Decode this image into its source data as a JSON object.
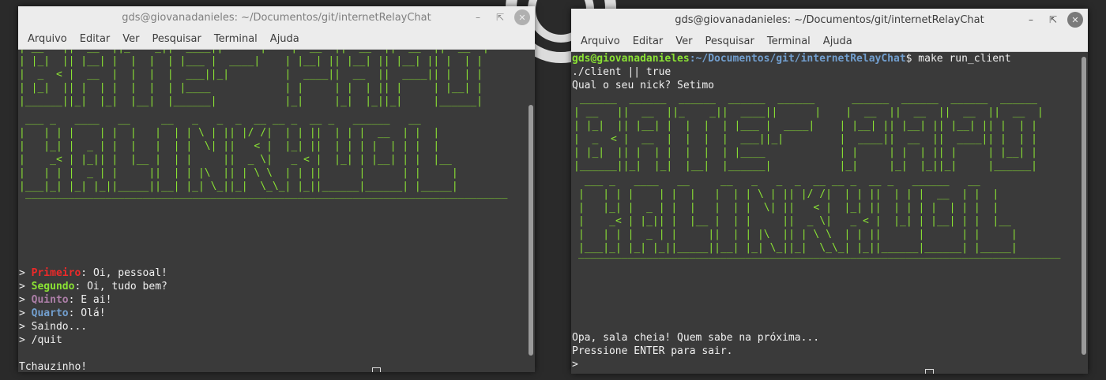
{
  "background": {
    "ring_color": "#dcdcdc",
    "desktop_color": "#2a2a2a"
  },
  "menu": [
    "Arquivo",
    "Editar",
    "Ver",
    "Pesquisar",
    "Terminal",
    "Ajuda"
  ],
  "left_window": {
    "title": "gds@giovanadanieles: ~/Documentos/git/internetRelayChat",
    "chat": [
      {
        "prompt": "> ",
        "nick": "Primeiro",
        "sep": ": ",
        "text": "Oi, pessoal!",
        "color": "#ef2929"
      },
      {
        "prompt": "> ",
        "nick": "Segundo",
        "sep": ": ",
        "text": "Oi, tudo bem?",
        "color": "#8ae234"
      },
      {
        "prompt": "> ",
        "nick": "Quinto",
        "sep": ": ",
        "text": "E ai!",
        "color": "#ad7fa8"
      },
      {
        "prompt": "> ",
        "nick": "Quarto",
        "sep": ": ",
        "text": "Olá!",
        "color": "#729fcf"
      }
    ],
    "line_saindo": "> Saindo...",
    "line_quit": "> /quit",
    "line_bye": "Tchauzinho!"
  },
  "right_window": {
    "title": "gds@giovanadanieles: ~/Documentos/git/internetRelayChat",
    "prompt_user": "gds@giovanadanieles",
    "prompt_path": ":~/Documentos/git/internetRelayChat",
    "prompt_cmd": "$ make run_client",
    "line_client": "./client || true",
    "line_nick": "Qual o seu nick? Setimo",
    "line_full": "Opa, sala cheia! Quem sabe na próxima...",
    "line_enter": "Pressione ENTER para sair.",
    "line_cursor": ">"
  },
  "banner": {
    "color": "#8ae234",
    "bate_papo": [
      " ______  ______  ______  ______  ______      ______  ______  ______  ______ ",
      "| __   ||  __  ||_    _||  ____||      |    |  __  ||  __  ||  __  ||  __  |",
      "| |_|  || |__| |  |  |  | |___ |  ____|    | |__| || |__| || |__| || |  | |",
      "|  _  < |  __  |  |  |  |  ___||_|         |  ____||  __  ||  ____|| |  | |",
      "| |_|  || |  | |  |  |  | |____            | |     | |  | || |     | |__| |",
      "|______||_|  |_|  |__|  |______|           |_|     |_|  |_||_|     |______|"
    ],
    "kalinkuol": [
      " ___ _   ____   __     __   _   _  _  __ __ _  __ _   ______   __     ",
      "|   | | |    | |  |   |  | | \\ | || |/ /|  | | ||  | | |  __  | |  |    ",
      "|   |_| |  _ | |  |   |  | |  \\| ||   < |  |_| ||  | | | |  | | |  |    ",
      "|    _< | |_|| |  |__ |  | |     ||  _ \\|   _ < |  |_| | |__| | |  |__  ",
      "|   | | |  _ | |     ||  | | |\\  || | \\ \\  | | ||      |      | |     | ",
      "|___|_| |_| |_||_____||__| |_| \\_||_|  \\_\\_| |_||______|______| |_____| "
    ],
    "rule": "______________________________________________________________________________"
  }
}
